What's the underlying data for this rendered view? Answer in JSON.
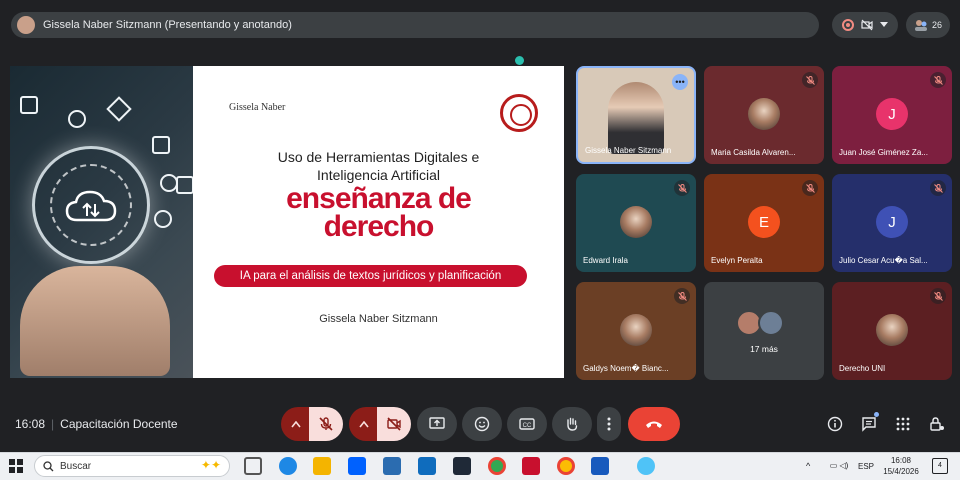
{
  "meet": {
    "presenter_label": "Gissela Naber Sitzmann (Presentando y anotando)",
    "participant_count": "26",
    "time": "16:08",
    "meeting_name": "Capacitación Docente"
  },
  "slide": {
    "logo": "Gissela Naber",
    "title_line1": "Uso de Herramientas Digitales e",
    "title_line2": "Inteligencia Artificial",
    "headline_line1": "enseñanza de",
    "headline_line2": "derecho",
    "subtitle": "IA para el análisis de textos jurídicos y planificación",
    "author": "Gissela Naber Sitzmann"
  },
  "tiles": [
    {
      "name": "Gissela Naber Sitzmann",
      "type": "video",
      "bg": "#d8c9b8"
    },
    {
      "name": "Maria Casilda Alvaren...",
      "type": "photo",
      "bg": "#6b2a2e",
      "muted": true
    },
    {
      "name": "Juan José Giménez Za...",
      "type": "initial",
      "initial": "J",
      "avatar_color": "#e8336b",
      "bg": "#7d1f3f",
      "muted": true
    },
    {
      "name": "Edward Irala",
      "type": "photo",
      "bg": "#1f4a52",
      "muted": true
    },
    {
      "name": "Evelyn Peralta",
      "type": "initial",
      "initial": "E",
      "avatar_color": "#f4511e",
      "bg": "#7a3216",
      "muted": true
    },
    {
      "name": "Julio Cesar Acu�a Sal...",
      "type": "initial",
      "initial": "J",
      "avatar_color": "#3f51b5",
      "bg": "#252f6b",
      "muted": true
    },
    {
      "name": "Galdys Noem� Bianc...",
      "type": "photo",
      "bg": "#6b3f25",
      "muted": true
    },
    {
      "name": "17 más",
      "type": "group",
      "bg": "#3c4043"
    },
    {
      "name": "Derecho UNI",
      "type": "photo",
      "bg": "#5c1f22",
      "muted": true
    }
  ],
  "taskbar": {
    "search_placeholder": "Buscar",
    "lang": "ESP",
    "time": "16:08",
    "date": "15/4/2026",
    "notifications": "4"
  },
  "colors": {
    "accent_red": "#c8102e",
    "end_call": "#ea4335",
    "meet_bg": "#202124"
  }
}
